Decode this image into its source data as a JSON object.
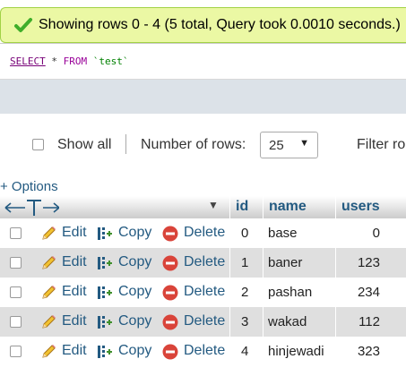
{
  "message": "Showing rows 0 - 4 (5 total, Query took 0.0010 seconds.)",
  "sql": {
    "select": "SELECT",
    "star": " * ",
    "from": "FROM",
    "table": " `test`"
  },
  "nav": {
    "show_all": "Show all",
    "number_of_rows_label": "Number of rows:",
    "rows_selected": "25",
    "filter_label": "Filter ro"
  },
  "options_label": "+ Options",
  "table": {
    "columns": [
      "id",
      "name",
      "users"
    ],
    "actions": {
      "edit": "Edit",
      "copy": "Copy",
      "delete": "Delete"
    },
    "rows": [
      {
        "id": "0",
        "name": "base",
        "users": "0"
      },
      {
        "id": "1",
        "name": "baner",
        "users": "123"
      },
      {
        "id": "2",
        "name": "pashan",
        "users": "234"
      },
      {
        "id": "3",
        "name": "wakad",
        "users": "112"
      },
      {
        "id": "4",
        "name": "hinjewadi",
        "users": "323"
      }
    ]
  },
  "colors": {
    "link": "#235a81",
    "success_bg": "#ebf8a4",
    "row_alt": "#dfdfdf",
    "delete_red": "#d9443a"
  },
  "icons": [
    "check-icon",
    "pencil-icon",
    "copy-icon",
    "delete-icon",
    "column-arrows-icon",
    "sort-arrow-icon"
  ]
}
